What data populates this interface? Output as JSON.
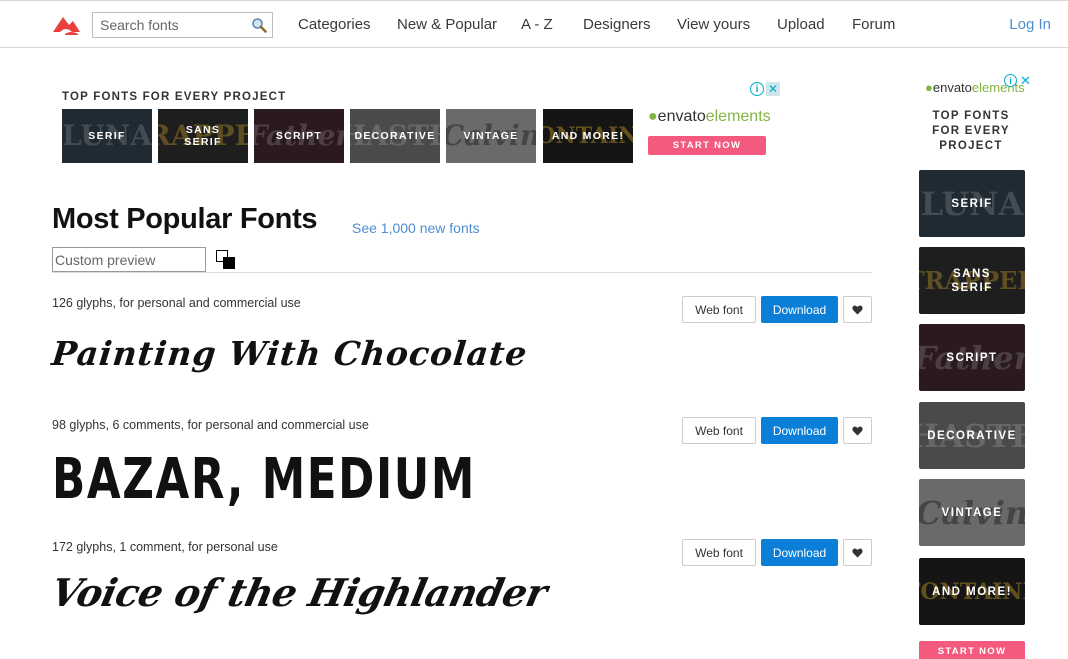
{
  "header": {
    "search_placeholder": "Search fonts",
    "nav": [
      "Categories",
      "New & Popular",
      "A - Z",
      "Designers",
      "View yours",
      "Upload",
      "Forum"
    ],
    "login": "Log In",
    "brand_color": "#e8403c"
  },
  "ad_banner": {
    "title": "TOP FONTS FOR EVERY PROJECT",
    "tiles": [
      {
        "label": "SERIF",
        "bg_word": "LUNA",
        "bg": "#1f2a33"
      },
      {
        "label": "SANS SERIF",
        "bg_word": "TRAPPER",
        "bg": "#1e1e1e"
      },
      {
        "label": "SCRIPT",
        "bg_word": "Father",
        "bg": "#2a1a1e"
      },
      {
        "label": "DECORATIVE",
        "bg_word": "HASTE",
        "bg": "#4a4a4a"
      },
      {
        "label": "VINTAGE",
        "bg_word": "Calvin",
        "bg": "#6a6a6a"
      },
      {
        "label": "AND MORE!",
        "bg_word": "FONTAINE",
        "bg": "#151515"
      }
    ],
    "envato_brand": "envato",
    "envato_product": "elements",
    "cta": "START NOW",
    "cta_color": "#f35a7d"
  },
  "main": {
    "title": "Most Popular Fonts",
    "new_fonts_link": "See 1,000 new fonts",
    "preview_placeholder": "Custom preview",
    "buttons": {
      "webfont": "Web font",
      "download": "Download"
    },
    "fonts": [
      {
        "meta": "126 glyphs, for personal and commercial use",
        "sample": "Painting With Chocolate"
      },
      {
        "meta": "98 glyphs, 6 comments, for personal and commercial use",
        "sample": "BAZAR, MEDIUM"
      },
      {
        "meta": "172 glyphs, 1 comment, for personal use",
        "sample": "Voice of the Highlander"
      }
    ],
    "download_color": "#0b7fd8"
  },
  "side_ad": {
    "envato_brand": "envato",
    "envato_product": "elements",
    "title": "TOP FONTS FOR EVERY PROJECT",
    "tiles": [
      {
        "label": "SERIF",
        "bg_word": "LUNA",
        "bg": "#1f2a33"
      },
      {
        "label": "SANS SERIF",
        "bg_word": "TRAPPER",
        "bg": "#1e1e1e"
      },
      {
        "label": "SCRIPT",
        "bg_word": "Father",
        "bg": "#2a1a1e"
      },
      {
        "label": "DECORATIVE",
        "bg_word": "HASTE",
        "bg": "#4a4a4a"
      },
      {
        "label": "VINTAGE",
        "bg_word": "Calvin",
        "bg": "#6a6a6a"
      },
      {
        "label": "AND MORE!",
        "bg_word": "FONTAINE",
        "bg": "#151515"
      }
    ],
    "cta": "START NOW"
  }
}
